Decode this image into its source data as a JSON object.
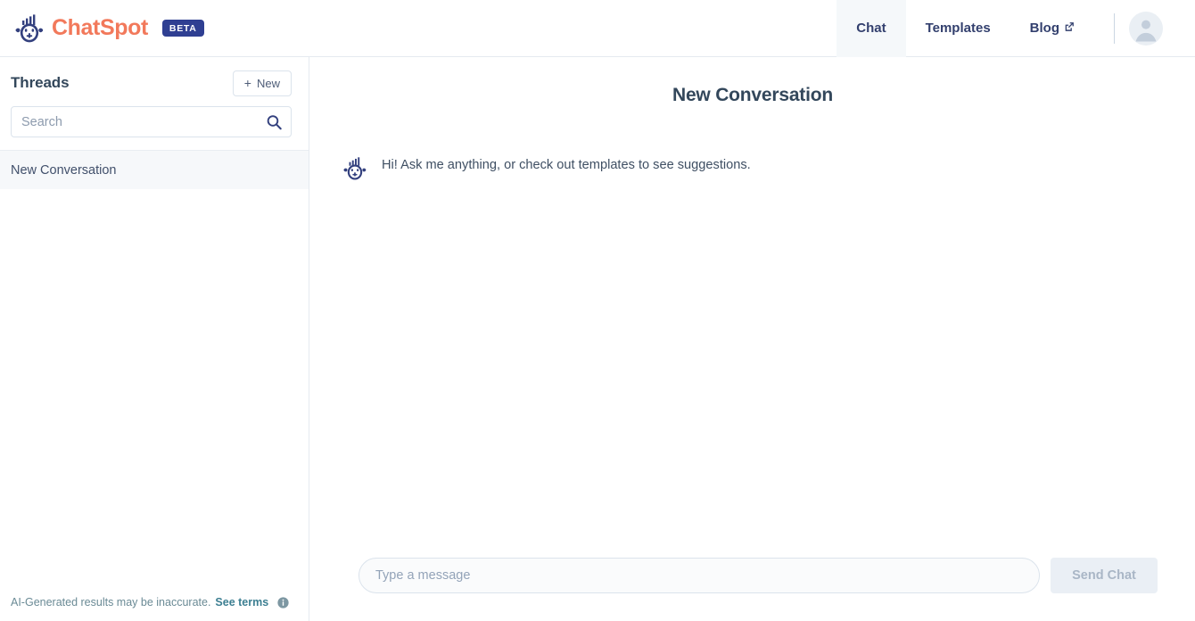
{
  "brand": {
    "name": "ChatSpot",
    "badge": "BETA",
    "logo_icon": "chatspot-face-chart-logo",
    "accent_color": "#f2795b",
    "badge_color": "#2f3f92"
  },
  "topnav": {
    "tabs": [
      {
        "label": "Chat",
        "active": true,
        "external": false
      },
      {
        "label": "Templates",
        "active": false,
        "external": false
      },
      {
        "label": "Blog",
        "active": false,
        "external": true,
        "icon": "external-link-icon"
      }
    ],
    "avatar_icon": "user-avatar-icon"
  },
  "sidebar": {
    "title": "Threads",
    "new_button": {
      "label": "New",
      "icon": "plus-icon"
    },
    "search": {
      "placeholder": "Search",
      "value": "",
      "icon": "search-icon"
    },
    "threads": [
      {
        "label": "New Conversation",
        "selected": true
      }
    ],
    "footer": {
      "text": "AI-Generated results may be inaccurate.",
      "link": "See terms",
      "info_icon": "info-circle-icon",
      "text_color": "#6a8a95",
      "link_color": "#3d7f92"
    }
  },
  "main": {
    "conversation_title": "New Conversation",
    "messages": [
      {
        "avatar_icon": "chatspot-bot-avatar-icon",
        "text": "Hi! Ask me anything, or check out templates to see suggestions."
      }
    ],
    "composer": {
      "placeholder": "Type a message",
      "value": "",
      "send_label": "Send Chat",
      "send_disabled": true
    }
  }
}
